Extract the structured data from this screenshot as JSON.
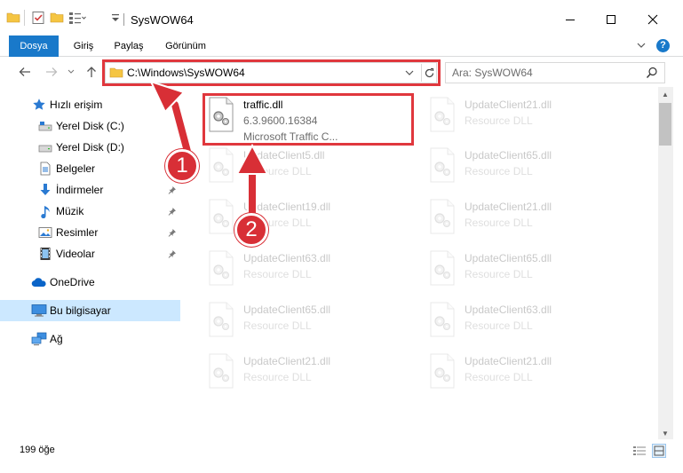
{
  "window": {
    "title": "SysWOW64",
    "minimize_glyph": "–",
    "maximize_glyph": "☐",
    "close_glyph": "✕"
  },
  "ribbon": {
    "tabs": [
      "Dosya",
      "Giriş",
      "Paylaş",
      "Görünüm"
    ],
    "help_glyph": "?"
  },
  "navbar": {
    "address_path": "C:\\Windows\\SysWOW64",
    "search_placeholder": "Ara: SysWOW64"
  },
  "sidebar": {
    "items": [
      {
        "label": "Hızlı erişim",
        "icon": "star-icon",
        "pinned": false
      },
      {
        "label": "Yerel Disk (C:)",
        "icon": "drive-icon",
        "pinned": false
      },
      {
        "label": "Yerel Disk (D:)",
        "icon": "drive-icon",
        "pinned": false
      },
      {
        "label": "Belgeler",
        "icon": "document-icon",
        "pinned": true
      },
      {
        "label": "İndirmeler",
        "icon": "download-icon",
        "pinned": true
      },
      {
        "label": "Müzik",
        "icon": "music-icon",
        "pinned": true
      },
      {
        "label": "Resimler",
        "icon": "pictures-icon",
        "pinned": true
      },
      {
        "label": "Videolar",
        "icon": "video-icon",
        "pinned": true
      },
      {
        "label": "OneDrive",
        "icon": "cloud-icon",
        "pinned": false
      },
      {
        "label": "Bu bilgisayar",
        "icon": "computer-icon",
        "pinned": false
      },
      {
        "label": "Ağ",
        "icon": "network-icon",
        "pinned": false
      }
    ]
  },
  "files": [
    {
      "name": "traffic.dll",
      "version": "6.3.9600.16384",
      "description": "Microsoft Traffic C...",
      "highlighted": true
    },
    {
      "name": "UpdateClient21.dll",
      "version": "Resource DLL",
      "description": ""
    },
    {
      "name": "UpdateClient5.dll",
      "version": "Resource DLL",
      "description": ""
    },
    {
      "name": "UpdateClient65.dll",
      "version": "Resource DLL",
      "description": ""
    },
    {
      "name": "UpdateClient19.dll",
      "version": "Resource DLL",
      "description": ""
    },
    {
      "name": "UpdateClient21.dll",
      "version": "Resource DLL",
      "description": ""
    },
    {
      "name": "UpdateClient63.dll",
      "version": "Resource DLL",
      "description": ""
    },
    {
      "name": "UpdateClient65.dll",
      "version": "Resource DLL",
      "description": ""
    },
    {
      "name": "UpdateClient65.dll",
      "version": "Resource DLL",
      "description": ""
    },
    {
      "name": "UpdateClient63.dll",
      "version": "Resource DLL",
      "description": ""
    },
    {
      "name": "UpdateClient21.dll",
      "version": "Resource DLL",
      "description": ""
    },
    {
      "name": "UpdateClient21.dll",
      "version": "Resource DLL",
      "description": ""
    }
  ],
  "status": {
    "item_count": "199 öğe"
  },
  "annotations": {
    "badge_1": "1",
    "badge_2": "2",
    "color": "#d82f36"
  },
  "colors": {
    "accent": "#1979ca",
    "selection": "#cce8ff",
    "highlight": "#e0373d"
  }
}
